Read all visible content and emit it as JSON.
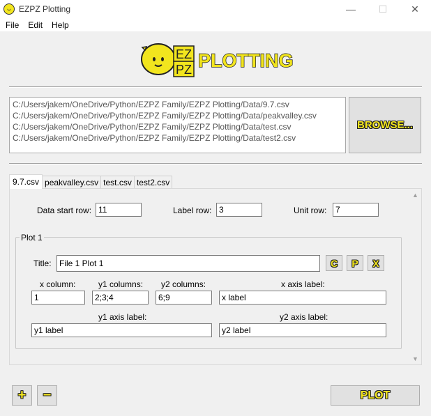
{
  "window": {
    "title": "EZPZ Plotting",
    "minimize": "—",
    "maximize": "☐",
    "close": "✕"
  },
  "menu": [
    "File",
    "Edit",
    "Help"
  ],
  "logo": {
    "ez": "EZ",
    "pz": "PZ",
    "word": "PLOTTING",
    "color": "#f2e51e"
  },
  "files": [
    "C:/Users/jakem/OneDrive/Python/EZPZ Family/EZPZ Plotting/Data/9.7.csv",
    "C:/Users/jakem/OneDrive/Python/EZPZ Family/EZPZ Plotting/Data/peakvalley.csv",
    "C:/Users/jakem/OneDrive/Python/EZPZ Family/EZPZ Plotting/Data/test.csv",
    "C:/Users/jakem/OneDrive/Python/EZPZ Family/EZPZ Plotting/Data/test2.csv"
  ],
  "browse_label": "BROWSE...",
  "tabs": [
    "9.7.csv",
    "peakvalley.csv",
    "test.csv",
    "test2.csv"
  ],
  "rows": {
    "data_start_label": "Data start row:",
    "data_start_value": "11",
    "label_row_label": "Label row:",
    "label_row_value": "3",
    "unit_row_label": "Unit row:",
    "unit_row_value": "7"
  },
  "plot": {
    "group_title": "Plot 1",
    "title_label": "Title:",
    "title_value": "File 1 Plot 1",
    "btn_c": "C",
    "btn_p": "P",
    "btn_x": "X",
    "x_column_label": "x column:",
    "x_column_value": "1",
    "y1_columns_label": "y1 columns:",
    "y1_columns_value": "2;3;4",
    "y2_columns_label": "y2 columns:",
    "y2_columns_value": "6;9",
    "x_axis_label_label": "x axis label:",
    "x_axis_label_value": "x label",
    "y1_axis_label_label": "y1 axis label:",
    "y1_axis_label_value": "y1 label",
    "y2_axis_label_label": "y2 axis label:",
    "y2_axis_label_value": "y2 label"
  },
  "bottom": {
    "add_label": "+",
    "remove_label": "−",
    "plot_label": "PLOT"
  },
  "icons": [
    "lemon-app-icon",
    "lemon-logo-icon",
    "scroll-up-icon",
    "scroll-down-icon"
  ]
}
